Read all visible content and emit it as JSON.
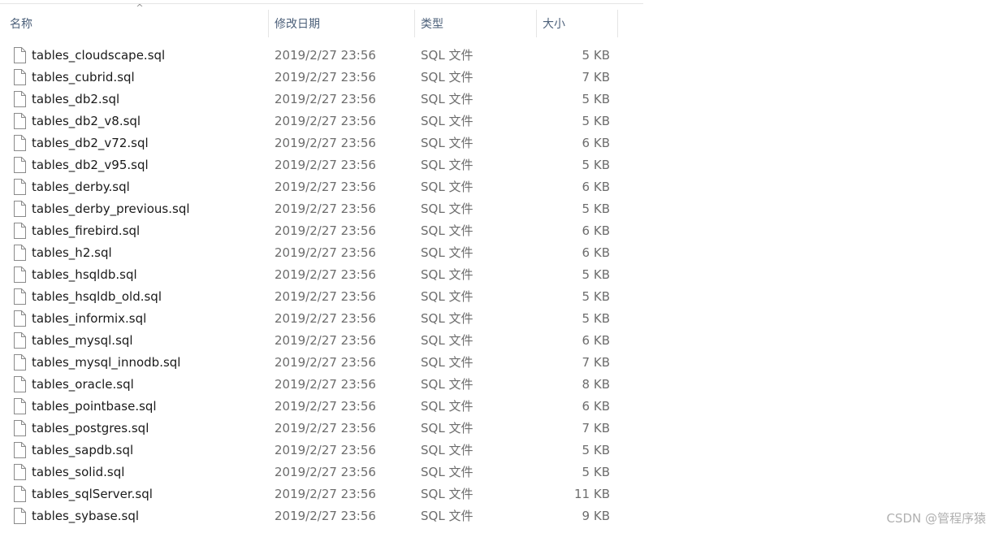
{
  "header": {
    "columns": {
      "name": "名称",
      "date": "修改日期",
      "type": "类型",
      "size": "大小"
    },
    "sort_indicator": "^"
  },
  "files": [
    {
      "name": "tables_cloudscape.sql",
      "date": "2019/2/27 23:56",
      "type": "SQL 文件",
      "size": "5 KB"
    },
    {
      "name": "tables_cubrid.sql",
      "date": "2019/2/27 23:56",
      "type": "SQL 文件",
      "size": "7 KB"
    },
    {
      "name": "tables_db2.sql",
      "date": "2019/2/27 23:56",
      "type": "SQL 文件",
      "size": "5 KB"
    },
    {
      "name": "tables_db2_v8.sql",
      "date": "2019/2/27 23:56",
      "type": "SQL 文件",
      "size": "5 KB"
    },
    {
      "name": "tables_db2_v72.sql",
      "date": "2019/2/27 23:56",
      "type": "SQL 文件",
      "size": "6 KB"
    },
    {
      "name": "tables_db2_v95.sql",
      "date": "2019/2/27 23:56",
      "type": "SQL 文件",
      "size": "5 KB"
    },
    {
      "name": "tables_derby.sql",
      "date": "2019/2/27 23:56",
      "type": "SQL 文件",
      "size": "6 KB"
    },
    {
      "name": "tables_derby_previous.sql",
      "date": "2019/2/27 23:56",
      "type": "SQL 文件",
      "size": "5 KB"
    },
    {
      "name": "tables_firebird.sql",
      "date": "2019/2/27 23:56",
      "type": "SQL 文件",
      "size": "6 KB"
    },
    {
      "name": "tables_h2.sql",
      "date": "2019/2/27 23:56",
      "type": "SQL 文件",
      "size": "6 KB"
    },
    {
      "name": "tables_hsqldb.sql",
      "date": "2019/2/27 23:56",
      "type": "SQL 文件",
      "size": "5 KB"
    },
    {
      "name": "tables_hsqldb_old.sql",
      "date": "2019/2/27 23:56",
      "type": "SQL 文件",
      "size": "5 KB"
    },
    {
      "name": "tables_informix.sql",
      "date": "2019/2/27 23:56",
      "type": "SQL 文件",
      "size": "5 KB"
    },
    {
      "name": "tables_mysql.sql",
      "date": "2019/2/27 23:56",
      "type": "SQL 文件",
      "size": "6 KB"
    },
    {
      "name": "tables_mysql_innodb.sql",
      "date": "2019/2/27 23:56",
      "type": "SQL 文件",
      "size": "7 KB"
    },
    {
      "name": "tables_oracle.sql",
      "date": "2019/2/27 23:56",
      "type": "SQL 文件",
      "size": "8 KB"
    },
    {
      "name": "tables_pointbase.sql",
      "date": "2019/2/27 23:56",
      "type": "SQL 文件",
      "size": "6 KB"
    },
    {
      "name": "tables_postgres.sql",
      "date": "2019/2/27 23:56",
      "type": "SQL 文件",
      "size": "7 KB"
    },
    {
      "name": "tables_sapdb.sql",
      "date": "2019/2/27 23:56",
      "type": "SQL 文件",
      "size": "5 KB"
    },
    {
      "name": "tables_solid.sql",
      "date": "2019/2/27 23:56",
      "type": "SQL 文件",
      "size": "5 KB"
    },
    {
      "name": "tables_sqlServer.sql",
      "date": "2019/2/27 23:56",
      "type": "SQL 文件",
      "size": "11 KB"
    },
    {
      "name": "tables_sybase.sql",
      "date": "2019/2/27 23:56",
      "type": "SQL 文件",
      "size": "9 KB"
    }
  ],
  "watermark": "CSDN @管程序猿",
  "icons": {
    "file": "document-icon",
    "sort": "sort-ascending-icon"
  },
  "colors": {
    "header_text": "#4c607a",
    "name_text": "#1a1a1a",
    "meta_text": "#6d6d6d",
    "separator": "#e5e5e5"
  }
}
